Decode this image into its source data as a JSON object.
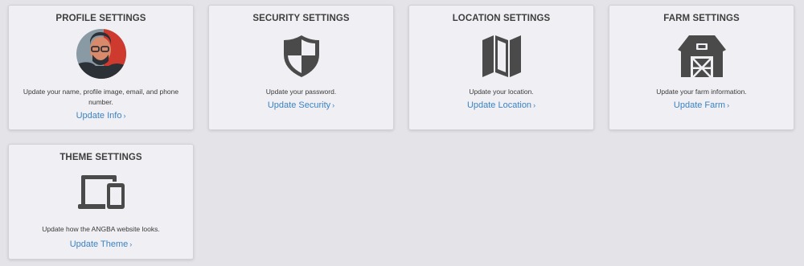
{
  "cards": [
    {
      "title": "PROFILE SETTINGS",
      "description": "Update your name, profile image, email, and phone number.",
      "link": "Update Info",
      "icon": "profile-avatar"
    },
    {
      "title": "SECURITY SETTINGS",
      "description": "Update your password.",
      "link": "Update Security",
      "icon": "shield-icon"
    },
    {
      "title": "LOCATION SETTINGS",
      "description": "Update your location.",
      "link": "Update Location",
      "icon": "map-icon"
    },
    {
      "title": "FARM SETTINGS",
      "description": "Update your farm information.",
      "link": "Update Farm",
      "icon": "barn-icon"
    },
    {
      "title": "THEME SETTINGS",
      "description": "Update how the ANGBA website looks.",
      "link": "Update Theme",
      "icon": "devices-icon"
    }
  ],
  "chevron": "›",
  "colors": {
    "link": "#3b82c4",
    "icon": "#4a4a4a",
    "card_bg": "#f0f0f4",
    "page_bg": "#e3e3e8"
  }
}
